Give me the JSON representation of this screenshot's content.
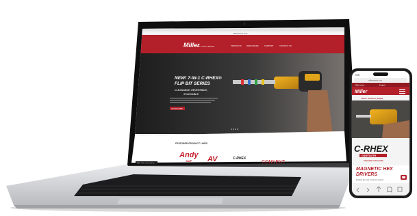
{
  "laptop": {
    "url": "millerstools.com",
    "brand": "Miller",
    "brand_sub": "MILL TOOLS BRAND",
    "nav": [
      "PRODUCTS",
      "RESOURCES",
      "SUPPORT",
      "CONTACT US"
    ],
    "hero": {
      "heading_line1": "NEW! 7-IN-1 C-RHEX®",
      "heading_line2": "FLIP BIT SERIES",
      "subheading_line1": "CLEANABLE, REVERSIBLE,",
      "subheading_line2": "STACKABLE",
      "cta": "LEARN MORE"
    },
    "featured_title": "FEATURED PRODUCT LINES",
    "product_lines": [
      "Andy",
      "SNIP",
      "AV",
      "C-RHEX",
      "CONNEXT"
    ],
    "status_tooltip": "Miller Tools is powered by..."
  },
  "phone": {
    "time": "9:00",
    "url": "millerstools.com",
    "header_links": [
      "Miller's Buy",
      "English"
    ],
    "brand": "Miller",
    "tagline": "Work. Perform. Adapt.",
    "product_logo": "C-RHEX",
    "product_logo_sub": "GAWTOOTH",
    "product_logo_note": "Cleanable & Reversible",
    "headline_line1": "MAGNETIC HEX",
    "headline_line2": "DRIVERS",
    "body_text": "Durable tips with enhanced grip for..."
  },
  "colors": {
    "brand_red": "#b3202a",
    "hero_dark": "#2b2b2b",
    "laptop_silver": "#d9dadd",
    "bezel": "#111111"
  }
}
